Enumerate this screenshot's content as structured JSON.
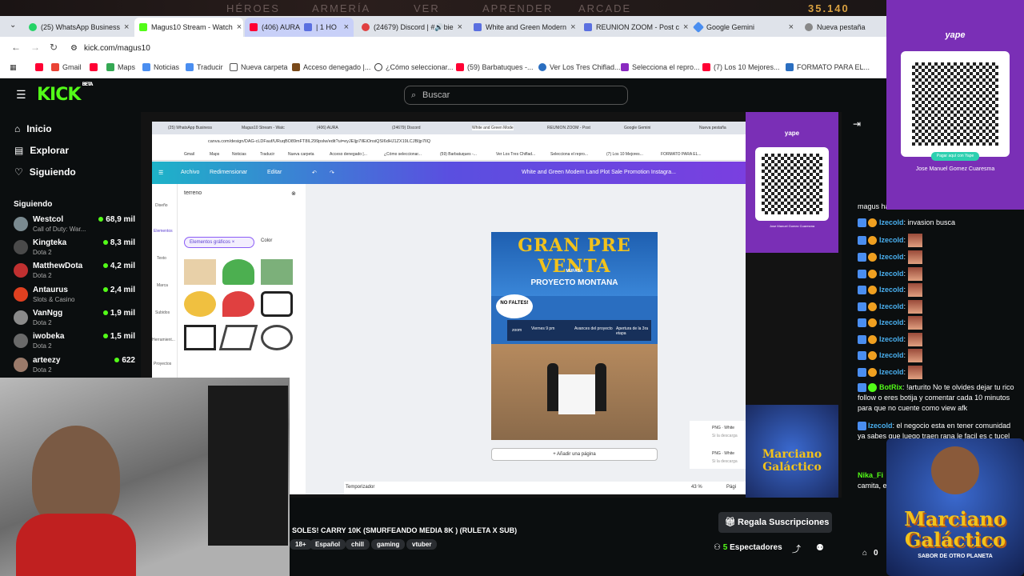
{
  "overlay_top": {
    "items": [
      "HÉROES",
      "ARMERÍA",
      "VER",
      "APRENDER",
      "ARCADE"
    ],
    "currency": "35.140"
  },
  "tabs": [
    {
      "label": "(25) WhatsApp Business",
      "color": "#25d366",
      "active": false
    },
    {
      "label": "Magus10 Stream - Watch",
      "color": "#53fc18",
      "active": true
    },
    {
      "label": "(406) AURA",
      "color": "#ff0033",
      "active": false
    },
    {
      "label": "| 1 HO",
      "color": "#5a6fe0",
      "active": false
    },
    {
      "label": "(24679) Discord | #🔊bie",
      "color": "#e04040",
      "active": false
    },
    {
      "label": "White and Green Modern",
      "color": "#5a6fe0",
      "active": false
    },
    {
      "label": "REUNION ZOOM - Post c",
      "color": "#5a6fe0",
      "active": false
    },
    {
      "label": "Google Gemini",
      "color": "#4a8ef0",
      "active": false
    },
    {
      "label": "Nueva pestaña",
      "color": "#888888",
      "active": false
    }
  ],
  "address": {
    "url": "kick.com/magus10"
  },
  "bookmarks": [
    {
      "label": "Gmail",
      "color": "#ea4335"
    },
    {
      "label": "Maps",
      "color": "#34a853"
    },
    {
      "label": "Noticias",
      "color": "#4a8ef0"
    },
    {
      "label": "Traducir",
      "color": "#4a8ef0"
    },
    {
      "label": "Nueva carpeta",
      "color": "#555555"
    },
    {
      "label": "Acceso denegado |...",
      "color": "#7a4a1a"
    },
    {
      "label": "¿Cómo seleccionar...",
      "color": "#333333"
    },
    {
      "label": "(59) Barbatuques -...",
      "color": "#ff0033"
    },
    {
      "label": "Ver Los Tres Chiflad...",
      "color": "#2a6ec0"
    },
    {
      "label": "Selecciona el repro...",
      "color": "#8a2ac0"
    },
    {
      "label": "(7) Los 10 Mejores...",
      "color": "#ff0033"
    },
    {
      "label": "FORMATO PARA EL...",
      "color": "#2a6ec0"
    }
  ],
  "kick": {
    "logo": "KICK",
    "beta": "BETA",
    "search_placeholder": "Buscar",
    "nav": [
      {
        "label": "Inicio",
        "icon": "home-icon"
      },
      {
        "label": "Explorar",
        "icon": "compass-icon"
      },
      {
        "label": "Siguiendo",
        "icon": "heart-icon"
      }
    ],
    "following_header": "Siguiendo",
    "channels": [
      {
        "name": "Westcol",
        "game": "Call of Duty: War...",
        "viewers": "68,9 mil",
        "color": "#7a8a90"
      },
      {
        "name": "Kingteka",
        "game": "Dota 2",
        "viewers": "8,3 mil",
        "color": "#4a4a4a"
      },
      {
        "name": "MatthewDota",
        "game": "Dota 2",
        "viewers": "4,2 mil",
        "color": "#c03030"
      },
      {
        "name": "Antaurus",
        "game": "Slots & Casino",
        "viewers": "2,4 mil",
        "color": "#e04020"
      },
      {
        "name": "VanNgg",
        "game": "Dota 2",
        "viewers": "1,9 mil",
        "color": "#8a8a8a"
      },
      {
        "name": "iwobeka",
        "game": "Dota 2",
        "viewers": "1,5 mil",
        "color": "#6a6a6a"
      },
      {
        "name": "arteezy",
        "game": "Dota 2",
        "viewers": "622",
        "color": "#9a7a6a"
      }
    ]
  },
  "inner_browser": {
    "url": "canva.com/design/DAG-cLDFauf/URuqBO89mFT8IL299pslw/edit?ui=eyJEIjp7IlEiOnsiQSI6dHJ1ZX19LCJBIjp7IlQ",
    "tabs": [
      "(25) WhatsApp Business",
      "Magus10 Stream - Watc",
      "(406) AURA",
      "(24679) Discord",
      "White and Green Mode",
      "REUNION ZOOM - Post",
      "Google Gemini",
      "Nueva pestaña"
    ],
    "bookmarks": [
      "Gmail",
      "Maps",
      "Noticias",
      "Traducir",
      "Nueva carpeta",
      "Acceso denegado |...",
      "¿Cómo seleccionar...",
      "(59) Barbatuques -...",
      "Ver Los Tres Chiflad...",
      "Selecciona el repro...",
      "(7) Los 10 Mejores...",
      "FORMATO PARA EL..."
    ],
    "canva": {
      "menu": [
        "Archivo",
        "Redimensionar",
        "Editar"
      ],
      "doc_title": "White and Green Modern Land Plot Sale Promotion Instagra...",
      "side_tools": [
        "Diseño",
        "Elementos",
        "Texto",
        "Marca",
        "Subidos",
        "Herramient...",
        "Proyectos"
      ],
      "search_value": "terreno",
      "chip": "Elementos gráficos",
      "filter": "Color",
      "add_page": "+ Añadir una página",
      "timer": "Temporizador",
      "zoom": "43 %",
      "pages": "Pági",
      "png_items": [
        "PNG · White",
        "PNG · White"
      ],
      "png_sub": "Si la descarga"
    },
    "poster": {
      "title": "GRAN PRE VENTA",
      "brand": "MUFASA",
      "subtitle": "PROYECTO MONTANA",
      "bubble": "NO FALTES!",
      "strip": [
        "zoom",
        "Viernes 9 pm",
        "Avances del proyecto",
        "Apertura de la 3ra etapa"
      ]
    }
  },
  "yape": {
    "brand": "yape",
    "button": "Pagar aquí con Yape",
    "name": "Jose Manuel Gomez Cuaresma"
  },
  "stream": {
    "title": "SOLES! CARRY 10K (SMURFEANDO MEDIA 8K ) (RULETA X SUB)",
    "tags": [
      "18+",
      "Español",
      "chill",
      "gaming",
      "vtuber"
    ],
    "gift_label": "Regala Suscripciones",
    "viewers_count": "5",
    "viewers_label": "Espectadores",
    "count_small": "0"
  },
  "sponsor": {
    "line1": "Marciano",
    "line2": "Galáctico",
    "tag": "SABOR DE OTRO PLANETA"
  },
  "chat": {
    "messages": [
      {
        "user": "",
        "text": "magus ha"
      },
      {
        "user": "Izecold",
        "text": ": invasion busca"
      },
      {
        "user": "Izecold",
        "text": ":",
        "emote": true
      },
      {
        "user": "Izecold",
        "text": ":",
        "emote": true
      },
      {
        "user": "Izecold",
        "text": ":",
        "emote": true
      },
      {
        "user": "Izecold",
        "text": ":",
        "emote": true
      },
      {
        "user": "Izecold",
        "text": ":",
        "emote": true
      },
      {
        "user": "Izecold",
        "text": ":",
        "emote": true
      },
      {
        "user": "Izecold",
        "text": ":",
        "emote": true
      },
      {
        "user": "Izecold",
        "text": ":",
        "emote": true
      },
      {
        "user": "Izecold",
        "text": ":",
        "emote": true
      }
    ],
    "bot_user": "BotRix",
    "bot_text": ": !arturito No te olvides dejar tu rico follow o eres botija y comentar cada 10 minutos para que no cuente como view afk",
    "iz_user": "Izecold",
    "iz_text": ": el negocio esta en tener comunidad ya sabes que luego traen rana le facil es c tucel",
    "nika_user": "Nika_Fi",
    "nika_text": "camita, e"
  }
}
